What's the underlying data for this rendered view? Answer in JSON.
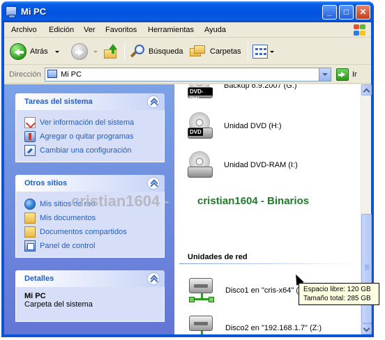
{
  "window": {
    "title": "Mi PC",
    "minimize": "_",
    "maximize": "□",
    "close": "✕"
  },
  "menu": [
    "Archivo",
    "Edición",
    "Ver",
    "Favoritos",
    "Herramientas",
    "Ayuda"
  ],
  "toolbar": {
    "back": "Atrás",
    "search": "Búsqueda",
    "folders": "Carpetas"
  },
  "address": {
    "label": "Dirección",
    "value": "Mi PC",
    "go": "Ir"
  },
  "tasks_system": {
    "title": "Tareas del sistema",
    "items": [
      "Ver información del sistema",
      "Agregar o quitar programas",
      "Cambiar una configuración"
    ]
  },
  "other_places": {
    "title": "Otros sitios",
    "items": [
      "Mis sitios de red",
      "Mis documentos",
      "Documentos compartidos",
      "Panel de control"
    ]
  },
  "details": {
    "title": "Detalles",
    "name": "Mi PC",
    "type": "Carpeta del sistema"
  },
  "drives": [
    {
      "label": "Backup 6.9.2007 (G:)",
      "badge": "DVD-RW"
    },
    {
      "label": "Unidad DVD (H:)",
      "badge": "DVD"
    },
    {
      "label": "Unidad DVD-RAM (I:)",
      "badge": ""
    }
  ],
  "network_section": "Unidades de red",
  "network_drives": [
    {
      "label": "Disco1 en \"cris-x64\" (Y:)"
    },
    {
      "label": "Disco2 en \"192.168.1.7\" (Z:)"
    }
  ],
  "tooltip": {
    "free": "Espacio libre: 120 GB",
    "total": "Tamaño total: 285 GB"
  },
  "watermark": {
    "left": "cristian1604 -",
    "right": "cristian1604 - Binarios"
  }
}
